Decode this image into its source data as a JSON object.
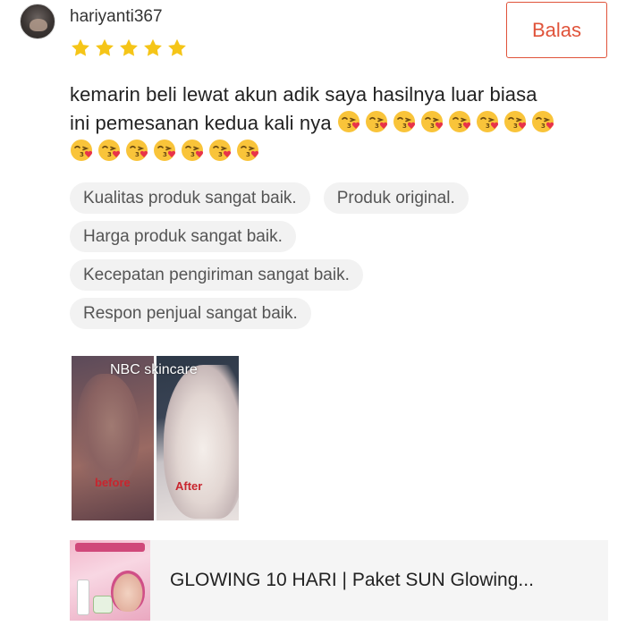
{
  "reviewer": {
    "username": "hariyanti367",
    "rating": 5,
    "avatar_icon": "avatar"
  },
  "reply_button": {
    "label": "Balas",
    "color": "#e0533a"
  },
  "review": {
    "line1": "kemarin beli lewat akun adik saya hasilnya luar biasa",
    "line2": "ini pemesanan kedua kali nya",
    "emoji_icon": "face-blowing-kiss-icon",
    "emoji_count_line2": 8,
    "emoji_count_line3": 7
  },
  "tags": [
    [
      "Kualitas produk sangat baik.",
      "Produk original."
    ],
    [
      "Harga produk sangat baik."
    ],
    [
      "Kecepatan pengiriman sangat baik."
    ],
    [
      "Respon penjual sangat baik."
    ]
  ],
  "photo": {
    "brand": "NBC skincare",
    "before_label": "before",
    "after_label": "After"
  },
  "product": {
    "title": "GLOWING 10 HARI | Paket SUN Glowing..."
  },
  "colors": {
    "accent": "#e0533a",
    "star": "#f5c518",
    "tag_bg": "#f2f2f2",
    "product_bg": "#f5f5f5"
  }
}
